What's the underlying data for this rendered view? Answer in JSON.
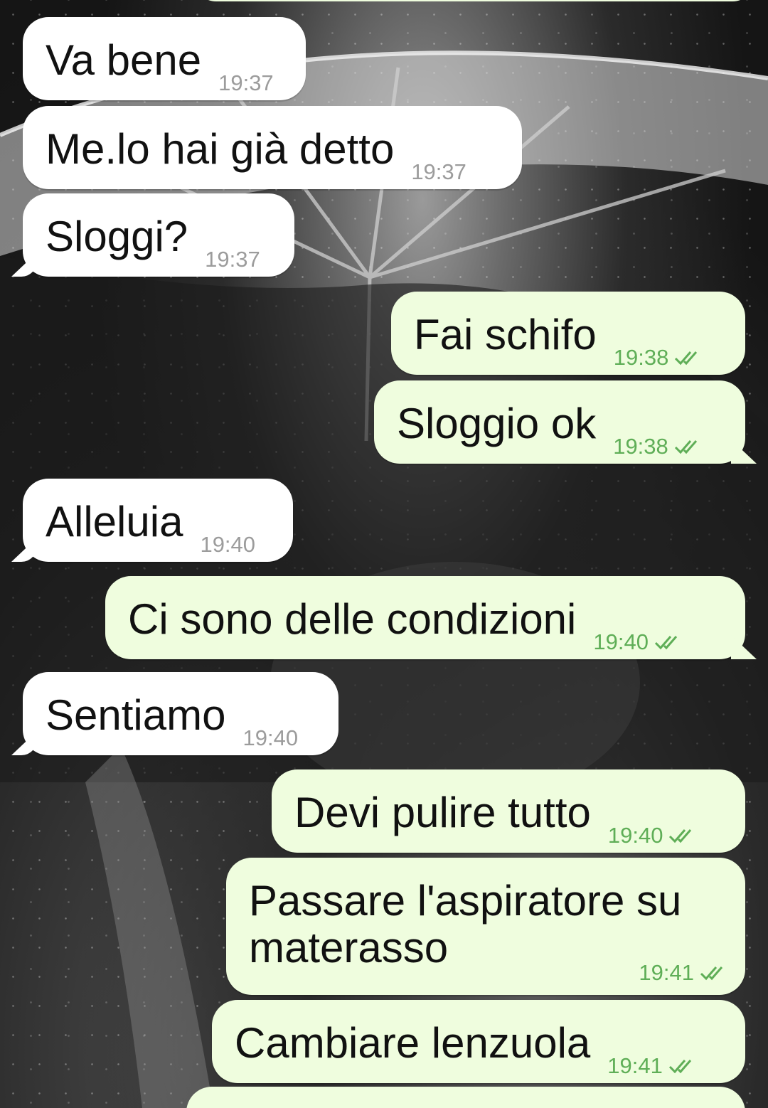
{
  "wallpaper": {
    "theme": "dark monochrome umbrella in rain",
    "bubble_in_color": "#ffffff",
    "bubble_out_color": "#effdde",
    "time_in_color": "#9c9c9c",
    "time_out_color": "#5fae57"
  },
  "messages": [
    {
      "direction": "in",
      "text": "Va bene",
      "time": "19:37"
    },
    {
      "direction": "in",
      "text": "Me.lo hai già detto",
      "time": "19:37"
    },
    {
      "direction": "in",
      "text": "Sloggi?",
      "time": "19:37"
    },
    {
      "direction": "out",
      "text": "Fai schifo",
      "time": "19:38",
      "status_icon": "double-check-icon"
    },
    {
      "direction": "out",
      "text": "Sloggio ok",
      "time": "19:38",
      "status_icon": "double-check-icon"
    },
    {
      "direction": "in",
      "text": "Alleluia",
      "time": "19:40"
    },
    {
      "direction": "out",
      "text": "Ci sono delle condizioni",
      "time": "19:40",
      "status_icon": "double-check-icon"
    },
    {
      "direction": "in",
      "text": "Sentiamo",
      "time": "19:40"
    },
    {
      "direction": "out",
      "text": "Devi pulire tutto",
      "time": "19:40",
      "status_icon": "double-check-icon"
    },
    {
      "direction": "out",
      "text": "Passare l'aspiratore su materasso",
      "time": "19:41",
      "status_icon": "double-check-icon"
    },
    {
      "direction": "out",
      "text": "Cambiare lenzuola",
      "time": "19:41",
      "status_icon": "double-check-icon"
    }
  ]
}
